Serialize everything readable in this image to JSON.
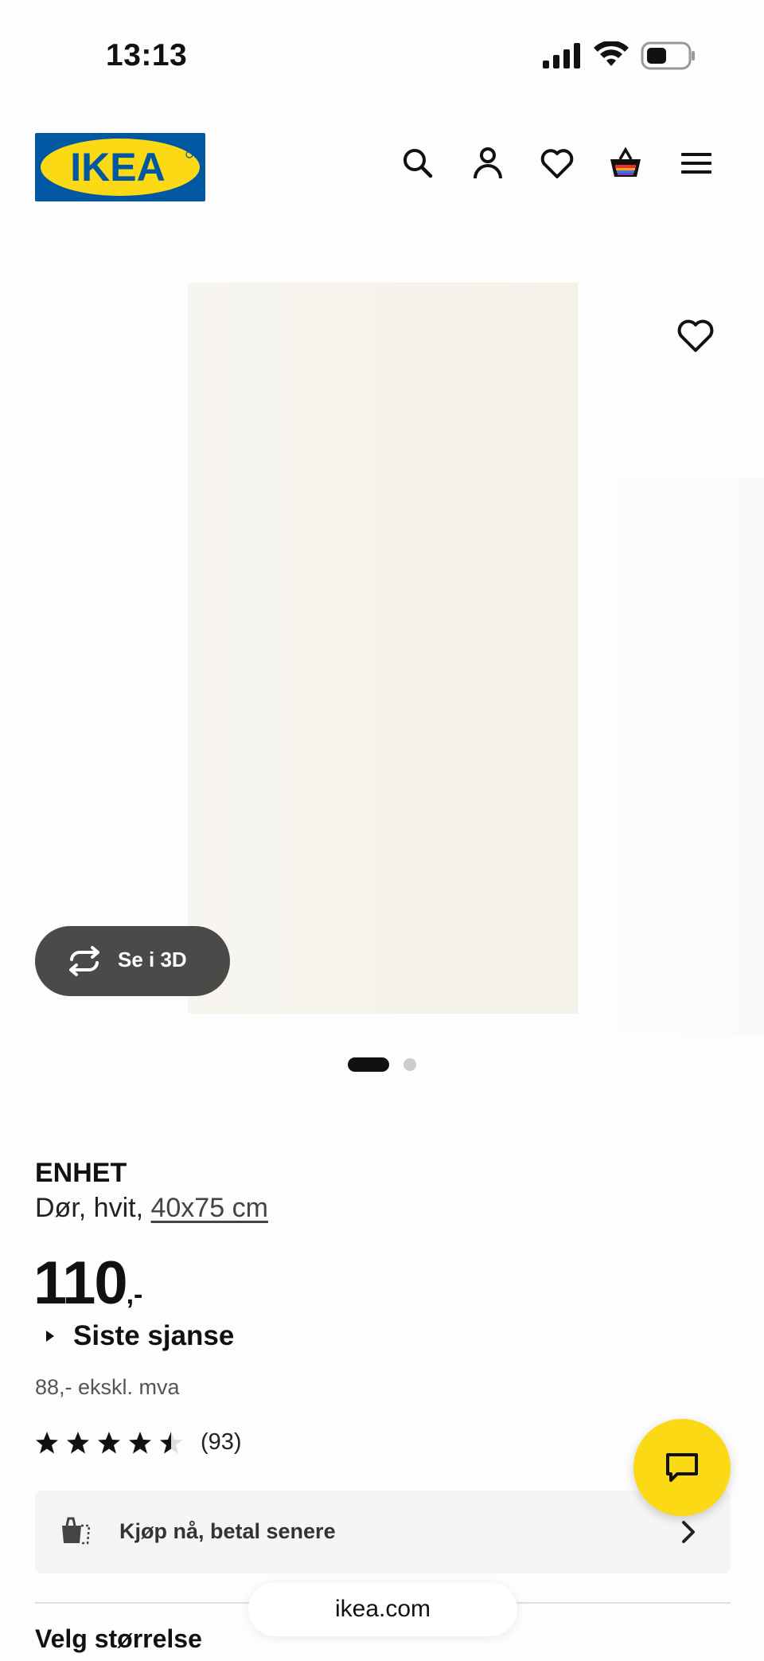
{
  "status_bar": {
    "time": "13:13"
  },
  "header": {
    "logo_text": "IKEA",
    "icons": [
      "search-icon",
      "account-icon",
      "heart-icon",
      "cart-icon",
      "menu-icon"
    ]
  },
  "gallery": {
    "view_3d_label": "Se i 3D",
    "slide_count": 2,
    "active_slide": 1
  },
  "product": {
    "name": "ENHET",
    "description_prefix": "Dør, hvit,",
    "size_link": "40x75 cm",
    "price_main": "110",
    "price_suffix": ",-",
    "last_chance_label": "Siste sjanse",
    "price_ex_vat": "88,- ekskl. mva",
    "rating": 4.5,
    "rating_max": 5,
    "review_count": "(93)"
  },
  "payment": {
    "bnpl_label": "Kjøp nå, betal senere"
  },
  "size_section": {
    "heading": "Velg størrelse"
  },
  "browser": {
    "url": "ikea.com"
  },
  "colors": {
    "brand_blue": "#0058a3",
    "brand_yellow": "#fbd914",
    "button_dark": "#4a4a49"
  }
}
